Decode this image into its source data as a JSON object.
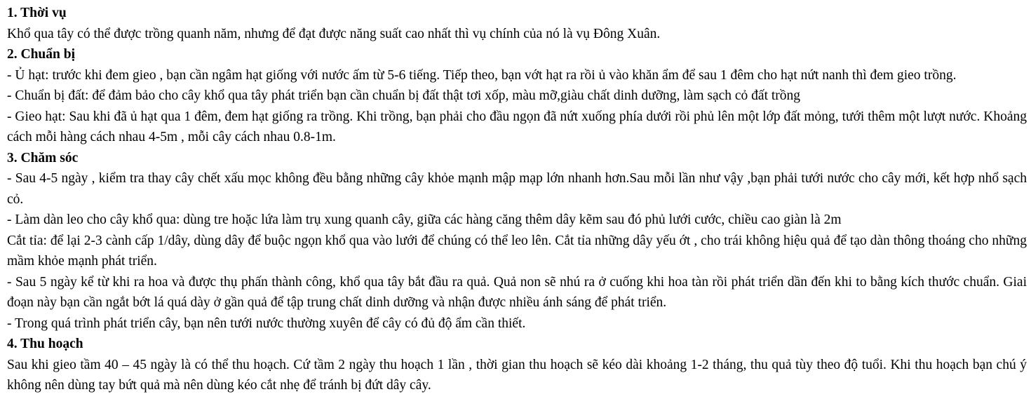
{
  "document": {
    "sections": [
      {
        "heading": "1. Thời vụ",
        "paragraphs": [
          "Khổ qua tây có thể được trồng quanh năm, nhưng để đạt được năng suất cao nhất thì vụ chính của nó là vụ Đông Xuân."
        ]
      },
      {
        "heading": "2. Chuẩn bị",
        "paragraphs": [
          "- Ủ hạt: trước khi đem gieo , bạn cần ngâm hạt giống với nước ấm từ 5-6 tiếng. Tiếp theo, bạn vớt hạt ra rồi ủ vào khăn ẩm để sau 1 đêm cho hạt nứt nanh thì đem gieo trồng.",
          "- Chuẩn bị đất: để đảm bảo cho cây khổ qua tây phát triển bạn cần chuẩn bị đất thật tơi xốp, màu mỡ,giàu chất dinh dưỡng, làm sạch cỏ đất trồng",
          "- Gieo hạt: Sau khi đã ủ hạt qua 1 đêm, đem hạt giống ra trồng. Khi trồng, bạn phải cho đầu ngọn đã nứt xuống phía dưới rồi phủ lên một lớp đất mỏng, tưới thêm một lượt nước. Khoảng cách mỗi hàng cách nhau 4-5m , mỗi cây cách nhau 0.8-1m."
        ]
      },
      {
        "heading": "3. Chăm sóc",
        "paragraphs": [
          "- Sau 4-5 ngày , kiểm tra thay cây chết xấu mọc không đều bằng những cây khỏe mạnh mập mạp lớn nhanh hơn.Sau mỗi lần như vậy ,bạn phải tưới nước cho cây mới, kết hợp nhổ sạch cỏ.",
          "- Làm dàn leo cho cây khổ qua: dùng tre hoặc lứa làm trụ xung quanh cây, giữa các hàng căng thêm dây kẽm  sau đó phủ lưới cước, chiều cao giàn là 2m",
          "Cắt tỉa: để lại 2-3 cành cấp 1/dây,  dùng dây để buộc ngọn khổ qua vào lưới để chúng có thể leo lên. Cắt tỉa những dây yếu ớt , cho trái không hiệu quả để tạo dàn thông thoáng cho những mầm khỏe mạnh phát triển.",
          "- Sau 5 ngày kể từ khi ra hoa và được thụ phấn thành công, khổ qua tây bắt đầu ra quả. Quả non sẽ nhú ra ở cuống khi hoa tàn rồi phát triển dần đến khi to bằng kích thước chuẩn. Giai đoạn này bạn cần ngắt bớt lá quá dày ở gần quả để tập trung chất dinh dưỡng và nhận được nhiều ánh sáng để phát triển.",
          "- Trong quá trình phát triển cây, bạn nên tưới nước thường xuyên để cây có đủ độ ẩm cần thiết."
        ]
      },
      {
        "heading": "4. Thu hoạch",
        "paragraphs": [
          "Sau khi gieo tầm 40 – 45 ngày là có thể thu hoạch. Cứ tầm 2 ngày thu hoạch 1 lần , thời gian thu hoạch sẽ kéo dài khoảng 1-2 tháng, thu quả tùy theo độ tuổi. Khi thu hoạch bạn chú ý không nên dùng tay bứt quả mà nên dùng kéo cắt nhẹ để tránh bị đứt dây cây."
        ]
      }
    ]
  }
}
